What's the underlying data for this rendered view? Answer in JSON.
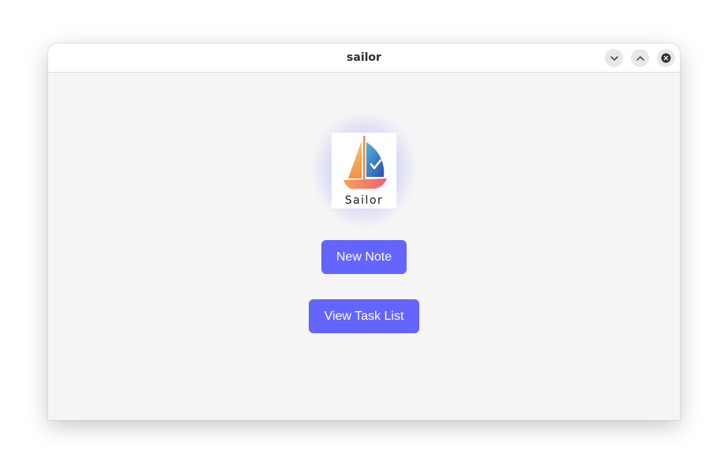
{
  "window": {
    "title": "sailor",
    "controls": {
      "minimize_icon": "chevron-down-icon",
      "maximize_icon": "chevron-up-icon",
      "close_icon": "close-icon"
    }
  },
  "logo": {
    "text": "Sailor",
    "glow_color": "#6e6eff"
  },
  "actions": {
    "new_note_label": "New Note",
    "view_task_list_label": "View Task List",
    "button_color": "#6464ff"
  }
}
